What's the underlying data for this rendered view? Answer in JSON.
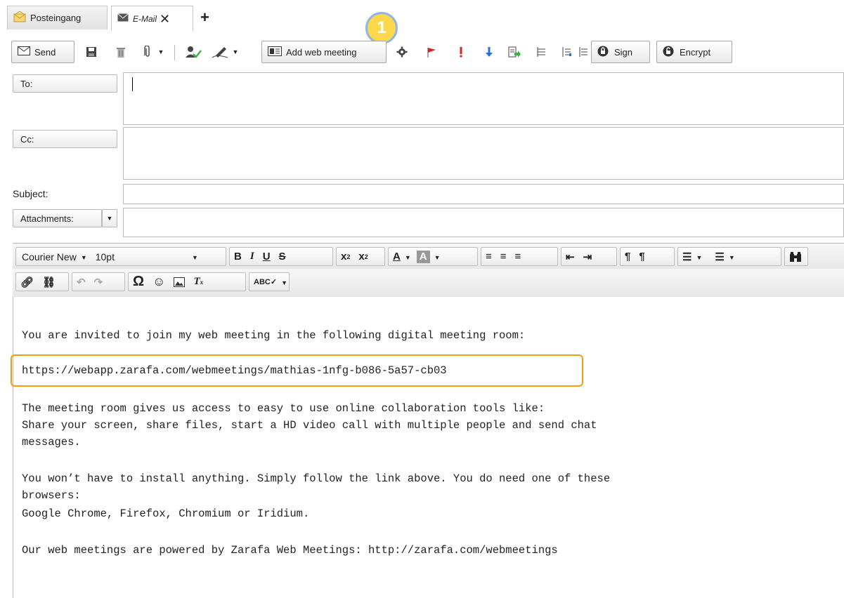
{
  "tabs": [
    {
      "label": "Posteingang",
      "icon": "envelope-open-icon"
    },
    {
      "label": "E-Mail",
      "icon": "envelope-icon",
      "active": true
    }
  ],
  "toolbar": {
    "send_label": "Send",
    "add_web_meeting_label": "Add web meeting",
    "sign_label": "Sign",
    "encrypt_label": "Encrypt"
  },
  "fields": {
    "to_label": "To:",
    "cc_label": "Cc:",
    "subject_label": "Subject:",
    "attachments_label": "Attachments:"
  },
  "editor_toolbar": {
    "font_family": "Courier New",
    "font_size": "10pt"
  },
  "marker_number": "1",
  "body": {
    "line1": "You are invited to join my web meeting in the following digital meeting room:",
    "link": "https://webapp.zarafa.com/webmeetings/mathias-1nfg-b086-5a57-cb03",
    "line3": "The meeting room gives us access to easy to use online collaboration tools like:",
    "line4": "Share your screen, share files, start a HD video call with multiple people and send chat",
    "line5": "messages.",
    "line6": "You won’t have to install anything. Simply follow the link above. You do need one of these",
    "line7": "browsers:",
    "line8": "Google Chrome, Firefox, Chromium or Iridium.",
    "line9": "Our web meetings are powered by Zarafa Web Meetings: http://zarafa.com/webmeetings"
  },
  "colors": {
    "highlight": "#f39c12",
    "marker": "#fdd84a"
  }
}
